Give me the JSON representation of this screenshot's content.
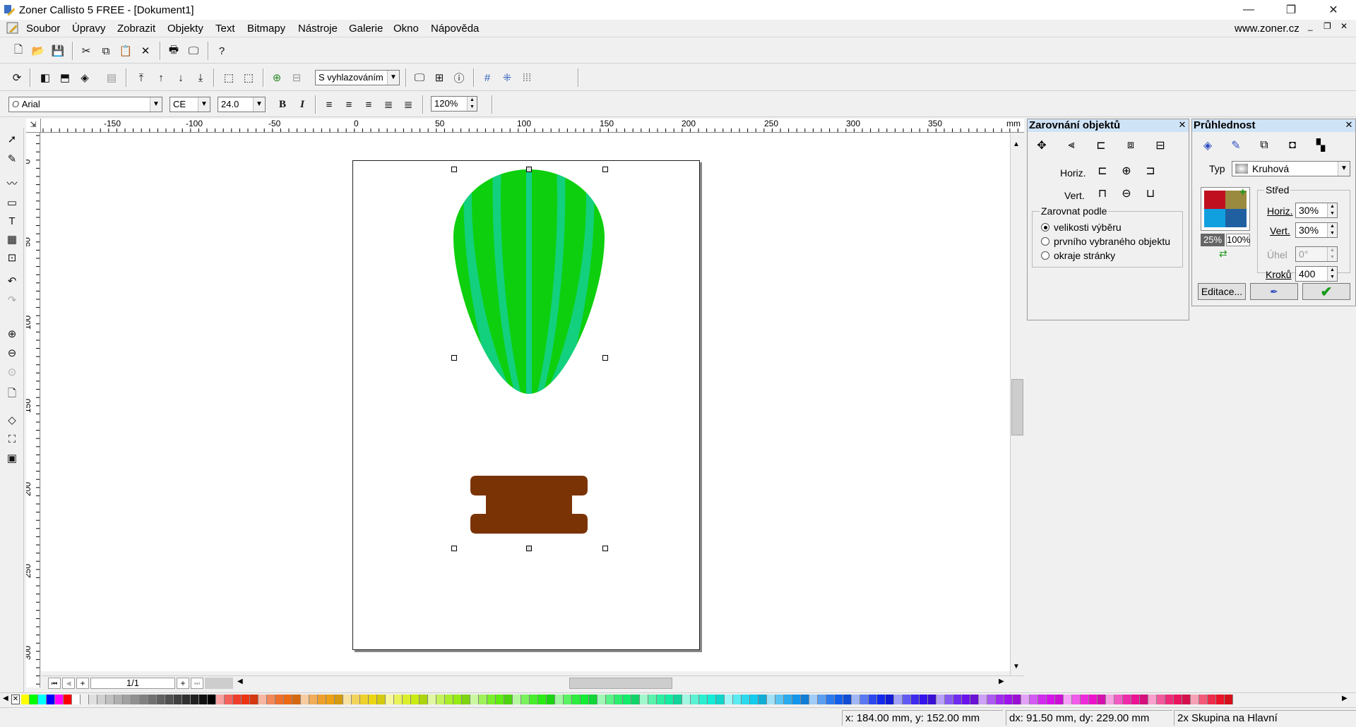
{
  "window": {
    "title": "Zoner Callisto 5 FREE - [Dokument1]",
    "minimize": "—",
    "restore": "❐",
    "close": "✕"
  },
  "menu": {
    "items": [
      "Soubor",
      "Úpravy",
      "Zobrazit",
      "Objekty",
      "Text",
      "Bitmapy",
      "Nástroje",
      "Galerie",
      "Okno",
      "Nápověda"
    ],
    "website": "www.zoner.cz"
  },
  "toolbar2": {
    "render_mode": "S vyhlazováním"
  },
  "textbar": {
    "font": "Arial",
    "charset": "CE",
    "size": "24.0",
    "bold": "B",
    "italic": "I",
    "zoom": "120%"
  },
  "ruler": {
    "unit": "mm",
    "h_labels": [
      "-150",
      "-100",
      "-50",
      "0",
      "50",
      "100",
      "150",
      "200",
      "250",
      "300",
      "350"
    ],
    "v_labels": [
      "0",
      "50",
      "100",
      "150",
      "200",
      "250",
      "300"
    ]
  },
  "pager": {
    "current": "1/1"
  },
  "align_panel": {
    "title": "Zarovnání objektů",
    "horiz_label": "Horiz.",
    "vert_label": "Vert.",
    "group_label": "Zarovnat podle",
    "options": [
      "velikosti výběru",
      "prvního vybraného objektu",
      "okraje stránky"
    ],
    "selected_option": "velikosti výběru"
  },
  "transparency_panel": {
    "title": "Průhlednost",
    "type_label": "Typ",
    "type_value": "Kruhová",
    "center_label": "Střed",
    "horiz_label": "Horiz.",
    "horiz_value": "30%",
    "vert_label": "Vert.",
    "vert_value": "30%",
    "angle_label": "Úhel",
    "angle_value": "0°",
    "steps_label": "Kroků",
    "steps_value": "400",
    "start_opacity": "25%",
    "end_opacity": "100%",
    "edit_button": "Editace..."
  },
  "status": {
    "coords": "x: 184.00 mm, y: 152.00 mm",
    "delta": "dx: 91.50 mm, dy: 229.00 mm",
    "selection": "2x Skupina na Hlavní"
  },
  "colors": {
    "balloon_light": "#13cf8a",
    "balloon_dark": "#0ecf0e",
    "basket": "#7a3305",
    "panel_header": "#cfe3f7"
  }
}
